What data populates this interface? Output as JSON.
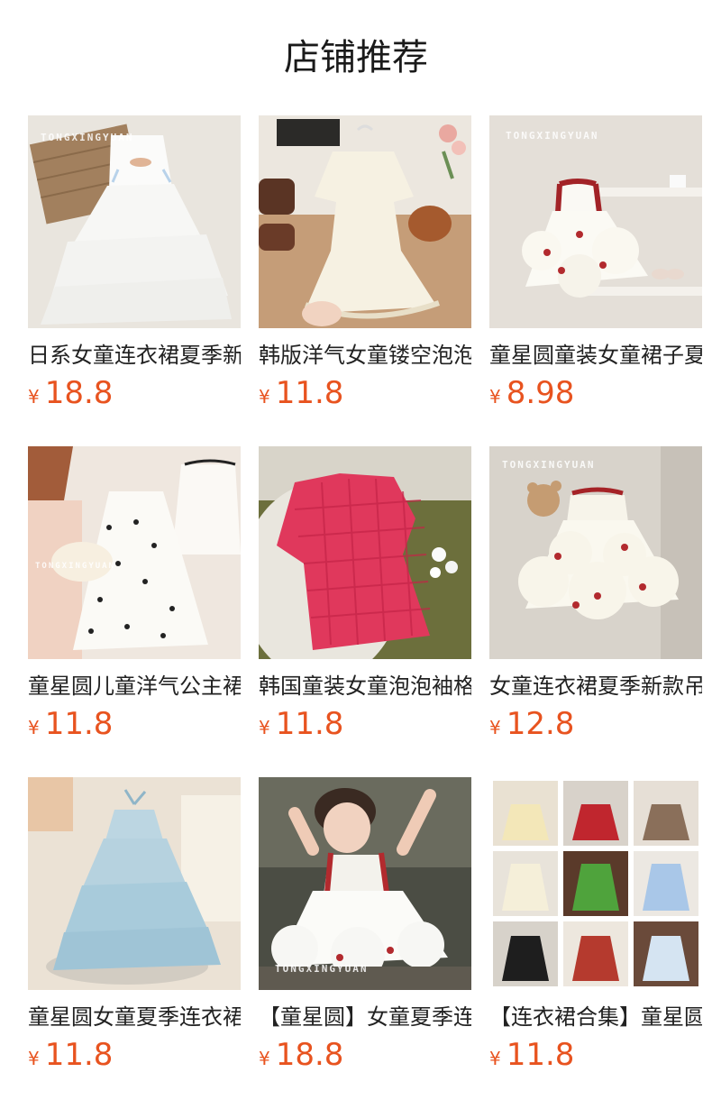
{
  "section": {
    "title": "店铺推荐"
  },
  "products": [
    {
      "name": "日系女童连衣裙夏季新款",
      "currency": "¥",
      "price": "18.8",
      "watermark": "TONGXINGYUAN"
    },
    {
      "name": "韩版洋气女童镂空泡泡袖",
      "currency": "¥",
      "price": "11.8",
      "watermark": ""
    },
    {
      "name": "童星圆童装女童裙子夏季",
      "currency": "¥",
      "price": "8.98",
      "watermark": "TONGXINGYUAN"
    },
    {
      "name": "童星圆儿童洋气公主裙",
      "currency": "¥",
      "price": "11.8",
      "watermark": "TONGXINGYUAN"
    },
    {
      "name": "韩国童装女童泡泡袖格子",
      "currency": "¥",
      "price": "11.8",
      "watermark": ""
    },
    {
      "name": "女童连衣裙夏季新款吊带",
      "currency": "¥",
      "price": "12.8",
      "watermark": "TONGXINGYUAN"
    },
    {
      "name": "童星圆女童夏季连衣裙",
      "currency": "¥",
      "price": "11.8",
      "watermark": ""
    },
    {
      "name": "【童星圆】女童夏季连衣",
      "currency": "¥",
      "price": "18.8",
      "watermark": "TONGXINGYUAN"
    },
    {
      "name": "【连衣裙合集】童星圆",
      "currency": "¥",
      "price": "11.8",
      "watermark": ""
    }
  ]
}
